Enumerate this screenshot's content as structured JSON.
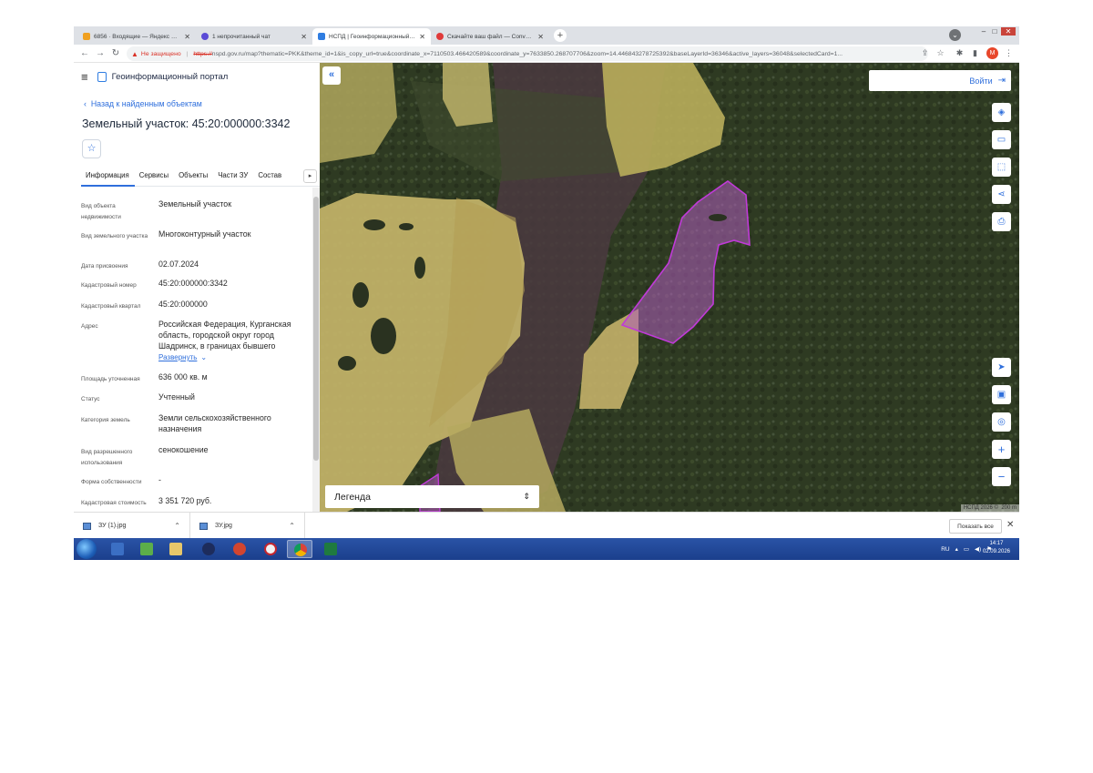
{
  "browser": {
    "tabs": [
      {
        "title": "6856 · Входящие — Яндекс Почта",
        "icon": "yandex-mail-icon",
        "color": "#f0a020",
        "active": false
      },
      {
        "title": "1 непрочитанный чат",
        "icon": "chat-icon",
        "color": "#5b4bd6",
        "active": false
      },
      {
        "title": "НСПД | Геоинформационный портал",
        "icon": "nspd-icon",
        "color": "#2f7de1",
        "active": true
      },
      {
        "title": "Скачайте ваш файл — Convertio",
        "icon": "convertio-icon",
        "color": "#e03a3a",
        "active": false
      }
    ],
    "new_tab": "+",
    "insecure_label": "Не защищено",
    "url_scheme": "https://",
    "url_rest": "nspd.gov.ru/map?thematic=PKK&theme_id=1&is_copy_url=true&coordinate_x=7110503.466420589&coordinate_y=7633850.268707706&zoom=14.446843278725392&baseLayerId=36346&active_layers=36048&selectedCard=1...",
    "profile_letter": "М"
  },
  "portal": {
    "title": "Геоинформационный портал",
    "back_link": "Назад к найденным объектам",
    "page_title": "Земельный участок: 45:20:000000:3342",
    "tabs": [
      "Информация",
      "Сервисы",
      "Объекты",
      "Части ЗУ",
      "Состав"
    ],
    "attributes": [
      {
        "label": "Вид объекта недвижимости",
        "value": "Земельный участок"
      },
      {
        "label": "Вид земельного участка",
        "value": "Многоконтурный участок"
      },
      {
        "label": "Дата присвоения",
        "value": "02.07.2024"
      },
      {
        "label": "Кадастровый номер",
        "value": "45:20:000000:3342"
      },
      {
        "label": "Кадастровый квартал",
        "value": "45:20:000000"
      },
      {
        "label": "Адрес",
        "value": "Российская Федерация, Курганская область, городской округ город Шадринск, в границах бывшего"
      },
      {
        "label": "Площадь уточненная",
        "value": "636 000 кв. м"
      },
      {
        "label": "Статус",
        "value": "Учтенный"
      },
      {
        "label": "Категория земель",
        "value": "Земли сельскохозяйственного назначения"
      },
      {
        "label": "Вид разрешенного использования",
        "value": "сенокошение"
      },
      {
        "label": "Форма собственности",
        "value": "-"
      },
      {
        "label": "Кадастровая стоимость",
        "value": "3 351 720 руб."
      }
    ],
    "expand_link": "Развернуть"
  },
  "map": {
    "login_label": "Войти",
    "legend_label": "Легенда",
    "attribution": "НСПД 2026 ©",
    "scale": "200 m",
    "tools": [
      "layers-icon",
      "ruler-icon",
      "select-area-icon",
      "share-icon",
      "print-icon",
      "locate-icon",
      "screenshot-icon",
      "tracking-icon",
      "zoom-in-icon",
      "zoom-out-icon"
    ]
  },
  "downloads": {
    "items": [
      "ЗУ (1).jpg",
      "ЗУ.jpg"
    ],
    "show_all": "Показать все"
  },
  "taskbar": {
    "language": "RU",
    "time": "14:17",
    "date": "02.09.2026"
  }
}
